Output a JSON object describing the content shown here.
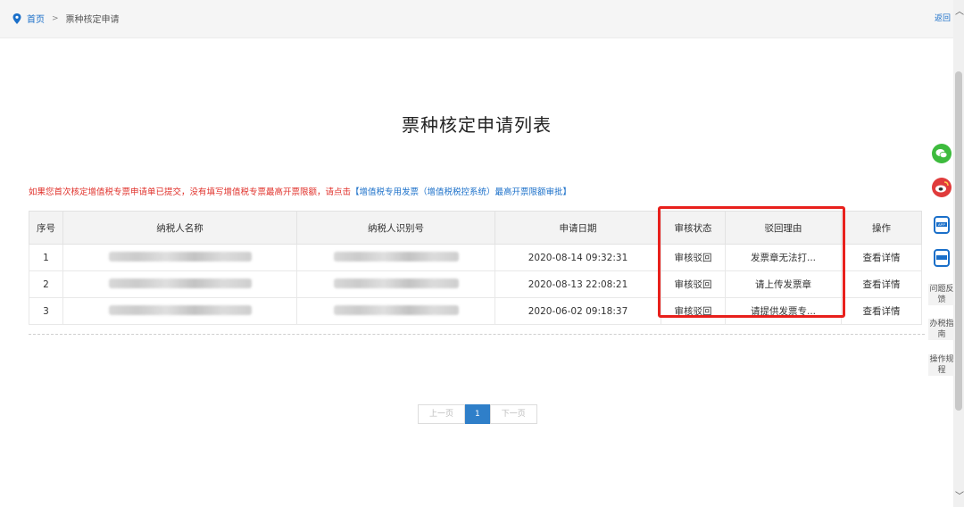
{
  "breadcrumb": {
    "home": "首页",
    "separator": ">",
    "current": "票种核定申请"
  },
  "back_label": "返回",
  "title": "票种核定申请列表",
  "notice": {
    "text": "如果您首次核定增值税专票申请单已提交，没有填写增值税专票最高开票限额，请点击",
    "link": "【增值税专用发票（增值税税控系统）最高开票限额审批】"
  },
  "table": {
    "headers": [
      "序号",
      "纳税人名称",
      "纳税人识别号",
      "申请日期",
      "审核状态",
      "驳回理由",
      "操作"
    ],
    "rows": [
      {
        "no": "1",
        "date": "2020-08-14 09:32:31",
        "status": "审核驳回",
        "reason": "发票章无法打...",
        "action": "查看详情"
      },
      {
        "no": "2",
        "date": "2020-08-13 22:08:21",
        "status": "审核驳回",
        "reason": "请上传发票章",
        "action": "查看详情"
      },
      {
        "no": "3",
        "date": "2020-06-02 09:18:37",
        "status": "审核驳回",
        "reason": "请提供发票专...",
        "action": "查看详情"
      }
    ]
  },
  "pagination": {
    "prev": "上一页",
    "current": "1",
    "next": "下一页"
  },
  "sidebar": {
    "feedback": "问题反馈",
    "guide": "办税指南",
    "rules": "操作规程"
  },
  "colors": {
    "accent": "#1a6fc9",
    "notice": "#e0302a",
    "highlight": "#e8201c"
  }
}
